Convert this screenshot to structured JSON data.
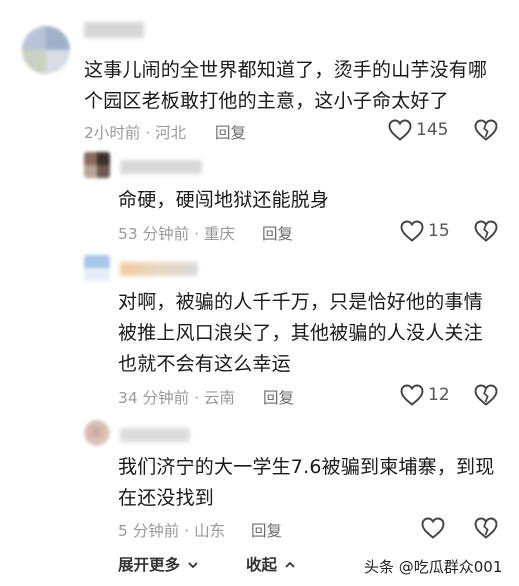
{
  "comments": [
    {
      "text": "这事儿闹的全世界都知道了，烫手的山芋没有哪个园区老板敢打他的主意，这小子命太好了",
      "line1": "这事儿闹的全世界都知道了，烫手的山芋没有哪",
      "line2": "个园区老板敢打他的主意，这小子命太好了",
      "meta": "2小时前 · 河北",
      "reply_label": "回复",
      "likes": "145"
    },
    {
      "text": "命硬，硬闯地狱还能脱身",
      "meta": "53 分钟前 · 重庆",
      "reply_label": "回复",
      "likes": "15"
    },
    {
      "line1": "对啊，被骗的人千千万，只是恰好他的事情",
      "line2": "被推上风口浪尖了，其他被骗的人没人关注",
      "line3": "也就不会有这么幸运",
      "meta": "34 分钟前 · 云南",
      "reply_label": "回复",
      "likes": "12"
    },
    {
      "line1": "我们济宁的大一学生7.6被骗到柬埔寨，到现",
      "line2": "在还没找到",
      "meta": "5 分钟前 · 山东",
      "reply_label": "回复",
      "likes": ""
    }
  ],
  "footer": {
    "expand_label": "展开更多",
    "collapse_label": "收起"
  },
  "watermark": "头条 @吃瓜群众001",
  "icons": {
    "like": "heart-icon",
    "dislike": "broken-heart-icon",
    "expand": "chevron-down-icon",
    "collapse": "chevron-up-icon"
  }
}
